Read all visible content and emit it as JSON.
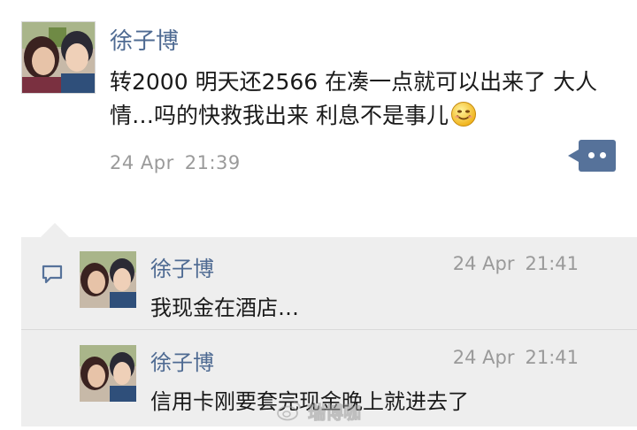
{
  "post": {
    "author": "徐子博",
    "text": "转2000 明天还2566 在凑一点就可以出来了 大人情…吗的快救我出来 利息不是事儿",
    "date": "24 Apr",
    "time": "21:39",
    "emoji": "smile-emoji",
    "more_button": "more-actions-icon"
  },
  "comments": [
    {
      "author": "徐子博",
      "date": "24 Apr",
      "time": "21:41",
      "text": "我现金在酒店…"
    },
    {
      "author": "徐子博",
      "date": "24 Apr",
      "time": "21:41",
      "text": "信用卡刚要套完现金晚上就进去了"
    }
  ],
  "watermark": {
    "icon": "weibo-logo",
    "text": "瑞博咖"
  },
  "colors": {
    "name": "#4e6a92",
    "accent_button": "#56729a",
    "timestamp": "#9a9a9a",
    "comment_bg": "#eeeeee"
  }
}
